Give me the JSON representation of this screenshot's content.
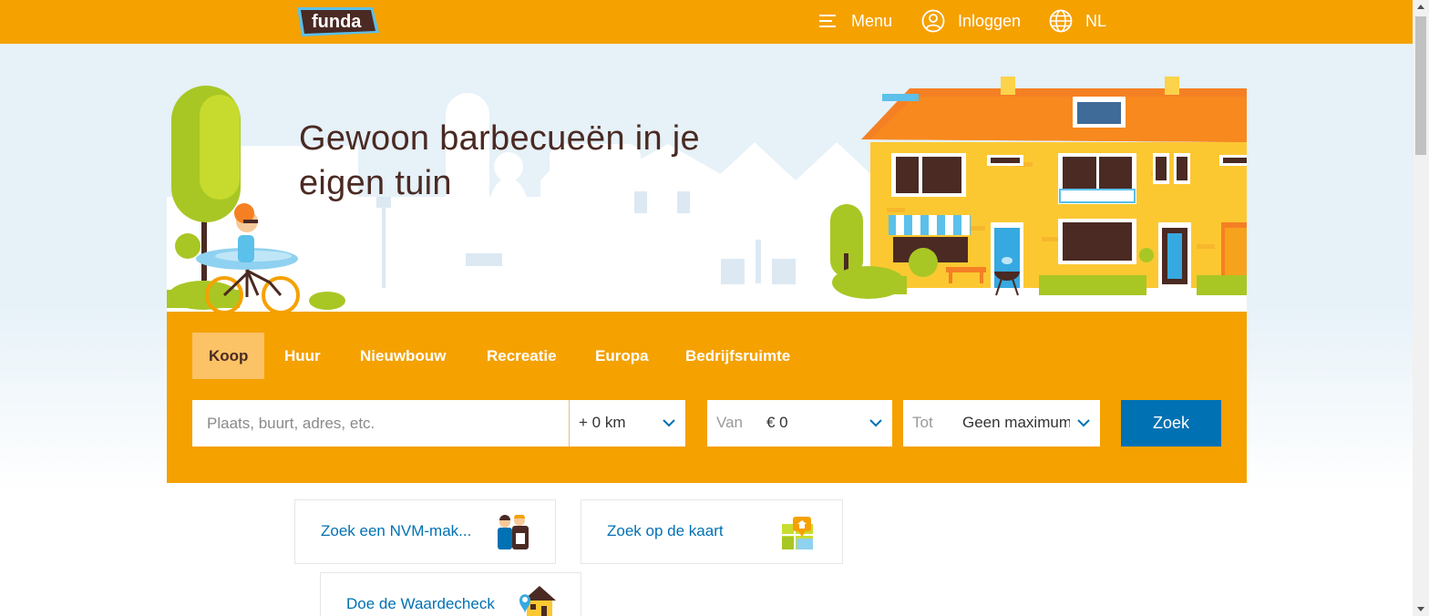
{
  "header": {
    "logo_text": "funda",
    "menu_label": "Menu",
    "login_label": "Inloggen",
    "language_label": "NL"
  },
  "hero": {
    "title": "Gewoon barbecueën in je eigen tuin"
  },
  "search": {
    "tabs": [
      {
        "label": "Koop",
        "active": true
      },
      {
        "label": "Huur",
        "active": false
      },
      {
        "label": "Nieuwbouw",
        "active": false
      },
      {
        "label": "Recreatie",
        "active": false
      },
      {
        "label": "Europa",
        "active": false
      },
      {
        "label": "Bedrijfsruimte",
        "active": false
      }
    ],
    "placeholder": "Plaats, buurt, adres, etc.",
    "radius_value": "+ 0 km",
    "min_price_label": "Van",
    "min_price_value": "€ 0",
    "max_price_label": "Tot",
    "max_price_value": "Geen maximum",
    "submit_label": "Zoek"
  },
  "quick_links": [
    {
      "label": "Zoek een NVM-mak...",
      "icon": "agents-icon"
    },
    {
      "label": "Zoek op de kaart",
      "icon": "map-icon"
    },
    {
      "label": "Doe de Waardecheck",
      "icon": "house-value-icon"
    }
  ],
  "colors": {
    "brand_orange": "#f5a100",
    "active_tab": "#fbc266",
    "button_blue": "#0071b3",
    "title_brown": "#4a2a23",
    "link_blue": "#0071b3"
  }
}
